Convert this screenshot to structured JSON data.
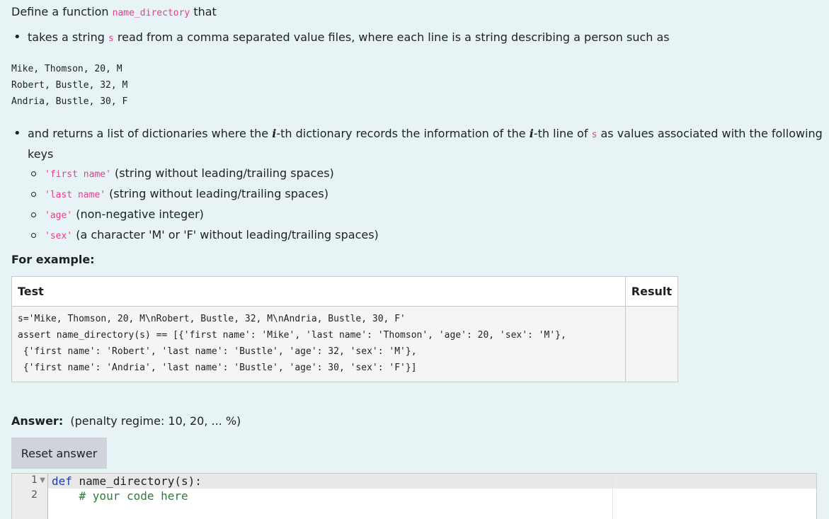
{
  "intro": {
    "define_text": "Define a function ",
    "function_name": "name_directory",
    "that_text": " that"
  },
  "bullet1": {
    "text_a": "takes a string ",
    "var_s": "s",
    "text_b": " read from a comma separated value files, where each line is a string describing a person such as"
  },
  "sample_lines": [
    "Mike, Thomson, 20, M",
    "Robert, Bustle, 32, M",
    "Andria, Bustle, 30, F"
  ],
  "bullet2": {
    "text_a": "and returns a list of dictionaries where the ",
    "ivar": "i",
    "text_b": "-th dictionary records the information of the ",
    "text_c": "-th line of ",
    "var_s": "s",
    "text_d": " as values associated with the following keys",
    "keys": [
      {
        "code": "'first name'",
        "desc": " (string without leading/trailing spaces)"
      },
      {
        "code": "'last name'",
        "desc": " (string without leading/trailing spaces)"
      },
      {
        "code": "'age'",
        "desc": " (non-negative integer)"
      },
      {
        "code": "'sex'",
        "desc": " (a character 'M' or 'F' without leading/trailing spaces)"
      }
    ]
  },
  "for_example": "For example:",
  "table": {
    "headers": [
      "Test",
      "Result"
    ],
    "test_code": "s='Mike, Thomson, 20, M\\nRobert, Bustle, 32, M\\nAndria, Bustle, 30, F'\nassert name_directory(s) == [{'first name': 'Mike', 'last name': 'Thomson', 'age': 20, 'sex': 'M'},\n {'first name': 'Robert', 'last name': 'Bustle', 'age': 32, 'sex': 'M'},\n {'first name': 'Andria', 'last name': 'Bustle', 'age': 30, 'sex': 'F'}]",
    "result": ""
  },
  "answer": {
    "label": "Answer:",
    "penalty": "(penalty regime: 10, 20, ... %)",
    "reset_label": "Reset answer"
  },
  "editor": {
    "line_numbers": [
      "1",
      "2"
    ],
    "line1_keyword": "def",
    "line1_rest": " name_directory(s):",
    "line2_comment": "    # your code here"
  }
}
